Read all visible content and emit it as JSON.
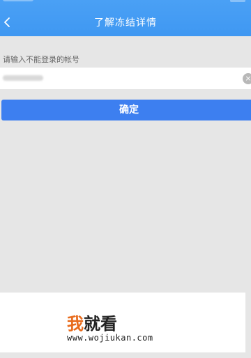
{
  "header": {
    "title": "了解冻结详情",
    "back_icon": "chevron-left-icon",
    "background": "#4aa0f5"
  },
  "form": {
    "account_label": "请输入不能登录的帐号",
    "account_value_obscured": true,
    "clear_icon": "clear-icon",
    "confirm_label": "确定",
    "confirm_color": "#3d7ff0"
  },
  "watermark": {
    "brand_first": "我",
    "brand_rest": "就看",
    "url": "www.wojiukan.com",
    "accent": "#e86b1c"
  }
}
